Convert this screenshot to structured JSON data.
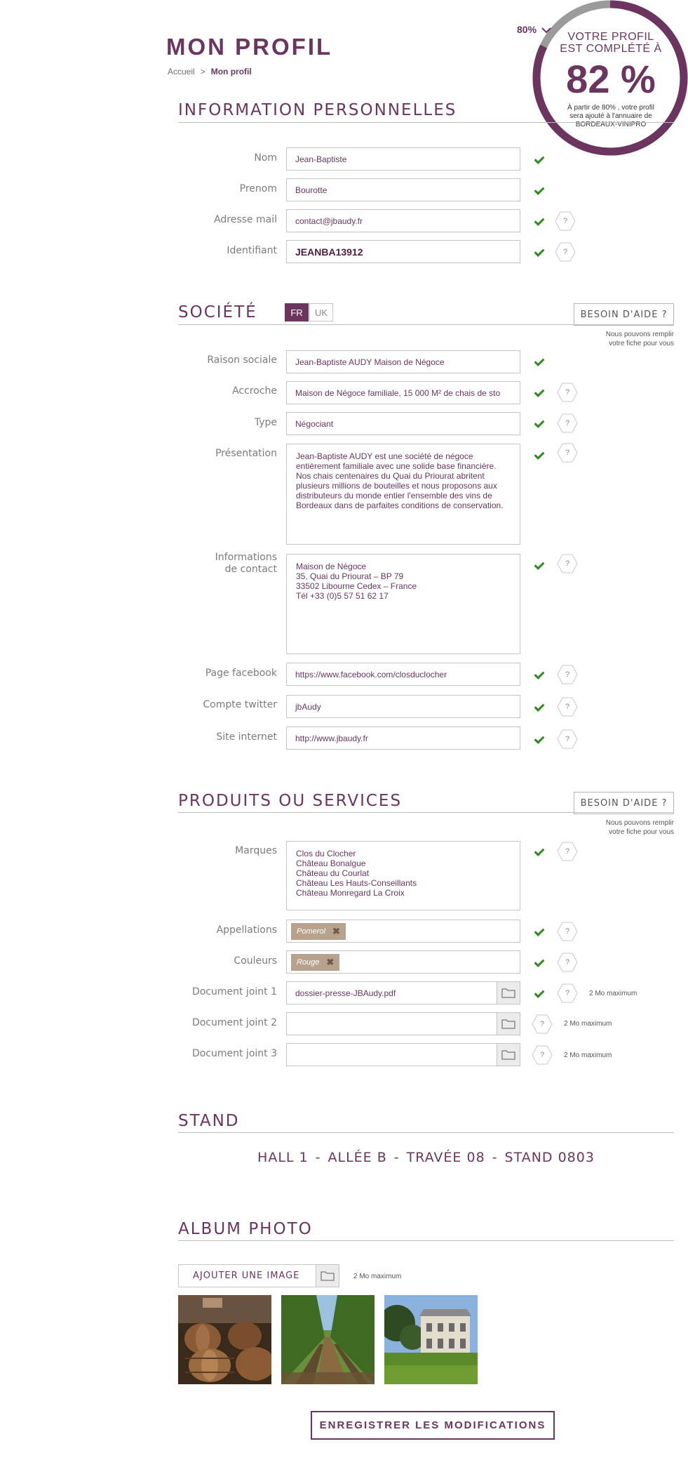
{
  "header": {
    "title": "MON PROFIL",
    "breadcrumb": {
      "home": "Accueil",
      "separator": ">",
      "current": "Mon profil"
    }
  },
  "badge": {
    "threshold_label": "80%",
    "line1": "VOTRE PROFIL",
    "line2": "EST COMPLÉTÉ À",
    "value": "82 %",
    "completion": 0.82,
    "threshold": 0.8,
    "note1": "À partir de 80% , votre profil",
    "note2": "sera ajouté à l'annuaire de",
    "note3": "BORDEAUX-VINIPRO"
  },
  "personal": {
    "title": "INFORMATION PERSONNELLES",
    "nom": {
      "label": "Nom",
      "value": "Jean-Baptiste"
    },
    "prenom": {
      "label": "Prenom",
      "value": "Bourotte"
    },
    "email": {
      "label": "Adresse mail",
      "value": "contact@jbaudy.fr"
    },
    "identifiant": {
      "label": "Identifiant",
      "value": "JEANBA13912"
    }
  },
  "societe": {
    "title": "SOCIÉTÉ",
    "lang_fr": "FR",
    "lang_uk": "UK",
    "help_button": "BESOIN D'AIDE ?",
    "help_note1": "Nous pouvons remplir",
    "help_note2": "votre fiche pour vous",
    "raison": {
      "label": "Raison sociale",
      "value": "Jean-Baptiste AUDY Maison de Négoce"
    },
    "accroche": {
      "label": "Accroche",
      "value": "Maison de Négoce familiale, 15 000 M² de chais de sto"
    },
    "type": {
      "label": "Type",
      "value": "Négociant"
    },
    "presentation": {
      "label": "Présentation",
      "value": "Jean-Baptiste AUDY est une société de négoce\nentièrement familiale avec une solide base financière.\nNos chais centenaires du Quai du Priourat abritent\nplusieurs millions de bouteilles et nous proposons aux\ndistributeurs du monde entier l'ensemble des vins de\nBordeaux dans de parfaites conditions de conservation."
    },
    "contact": {
      "label_line1": "Informations",
      "label_line2": "de contact",
      "value": "Maison de Négoce\n35, Quai du Priourat – BP 79\n33502 Libourne Cedex – France\nTél +33 (0)5 57 51 62 17"
    },
    "facebook": {
      "label": "Page facebook",
      "value": "https://www.facebook.com/closduclocher"
    },
    "twitter": {
      "label": "Compte twitter",
      "value": "jbAudy"
    },
    "site": {
      "label": "Site internet",
      "value": "http://www.jbaudy.fr"
    }
  },
  "produits": {
    "title": "PRODUITS OU SERVICES",
    "help_button": "BESOIN D'AIDE ?",
    "help_note1": "Nous pouvons remplir",
    "help_note2": "votre fiche pour vous",
    "marques": {
      "label": "Marques",
      "value": "Clos du Clocher\nChâteau Bonalgue\nChâteau du Courlat\nChâteau Les Hauts-Conseillants\nChâteau Monregard La Croix"
    },
    "appellations": {
      "label": "Appellations",
      "tag": "Pomerol"
    },
    "couleurs": {
      "label": "Couleurs",
      "tag": "Rouge"
    },
    "doc1": {
      "label": "Document joint 1",
      "value": "dossier-presse-JBAudy.pdf",
      "note": "2 Mo maximum"
    },
    "doc2": {
      "label": "Document joint 2",
      "value": "",
      "note": "2 Mo maximum"
    },
    "doc3": {
      "label": "Document joint 3",
      "value": "",
      "note": "2 Mo maximum"
    }
  },
  "stand": {
    "title": "STAND",
    "hall": "HALL 1",
    "allee": "ALLÉE B",
    "travee": "TRAVÉE 08",
    "stand": "STAND 0803",
    "separator": "-"
  },
  "album": {
    "title": "ALBUM PHOTO",
    "add_button": "AJOUTER UNE IMAGE",
    "note": "2 Mo maximum"
  },
  "actions": {
    "save": "ENREGISTRER LES MODIFICATIONS"
  },
  "help_symbol": "?",
  "remove_symbol": "✖",
  "colors": {
    "accent": "#6b3560",
    "check": "#2e8b1e",
    "tag": "#b8a28e"
  }
}
